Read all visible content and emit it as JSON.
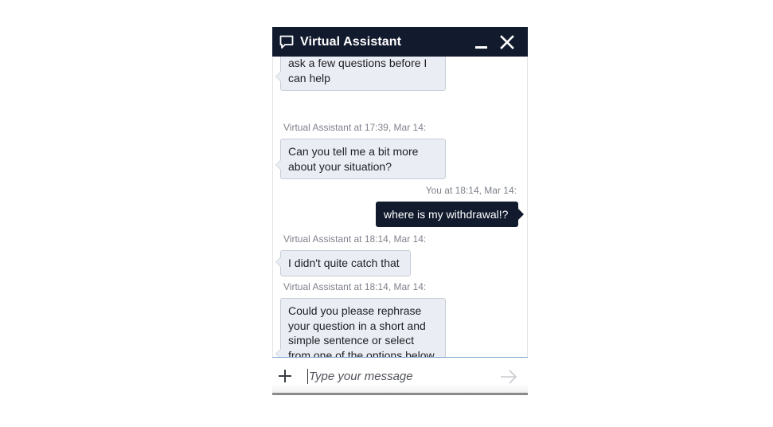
{
  "header": {
    "title": "Virtual Assistant",
    "icon": "chat-bubble-icon",
    "bg_color": "#121b2e"
  },
  "messages": [
    {
      "type": "incoming",
      "text": "ask a few questions before I can help"
    },
    {
      "type": "meta",
      "text": "Virtual Assistant at 17:39, Mar 14:"
    },
    {
      "type": "incoming",
      "text": "Can you tell me a bit more about your situation?"
    },
    {
      "type": "meta",
      "text": "You at 18:14, Mar 14:"
    },
    {
      "type": "outgoing",
      "text": "where is my withdrawal!?"
    },
    {
      "type": "meta",
      "text": "Virtual Assistant at 18:14, Mar 14:"
    },
    {
      "type": "incoming",
      "text": "I didn't quite catch that"
    },
    {
      "type": "meta",
      "text": "Virtual Assistant at 18:14, Mar 14:"
    },
    {
      "type": "incoming",
      "text": "Could you please rephrase your question in a short and simple sentence or select from one of the options below"
    }
  ],
  "composer": {
    "placeholder": "Type your message",
    "value": "",
    "add_icon": "plus-icon",
    "send_icon": "arrow-right-icon"
  },
  "colors": {
    "incoming_bubble": "#eaedf3",
    "incoming_border": "#c7ccd6",
    "outgoing_bubble": "#121b2e",
    "meta_text": "#7e828b"
  }
}
